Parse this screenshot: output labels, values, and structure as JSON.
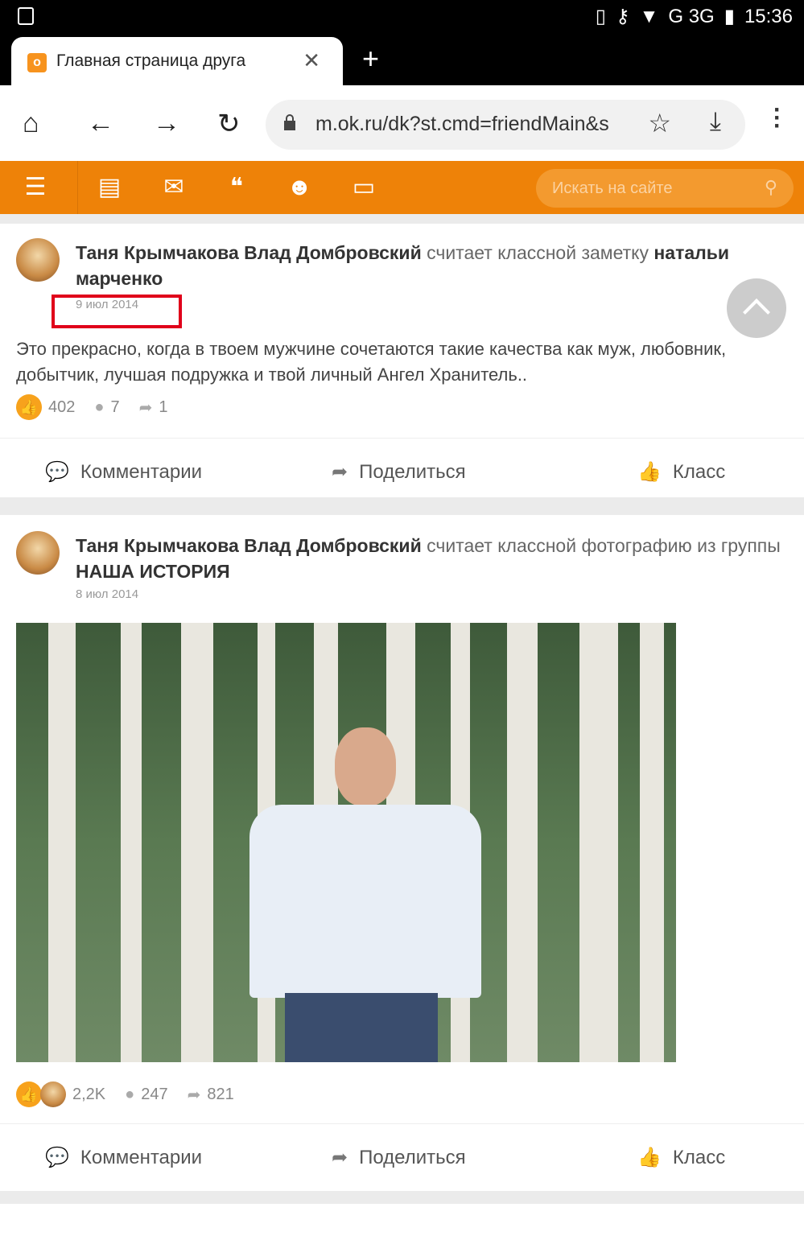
{
  "status_bar": {
    "time": "15:36",
    "network": "G 3G"
  },
  "browser": {
    "tab_title": "Главная страница друга",
    "url": "m.ok.ru/dk?st.cmd=friendMain&s"
  },
  "ok_header": {
    "search_placeholder": "Искать на сайте"
  },
  "posts": [
    {
      "authors": "Таня Крымчакова Влад Домбровский",
      "action": "считает классной заметку",
      "target": "натальи марченко",
      "date": "9 июл 2014",
      "text": "Это прекрасно, когда в твоем мужчине сочетаются такие качества как муж, любовник, добытчик, лучшая подружка и твой личный Ангел Хранитель..",
      "likes": "402",
      "comments": "7",
      "shares": "1"
    },
    {
      "authors": "Таня Крымчакова Влад Домбровский",
      "action": "считает классной фотографию из группы",
      "target": "НАША ИСТОРИЯ",
      "date": "8 июл 2014",
      "likes": "2,2K",
      "comments": "247",
      "shares": "821"
    }
  ],
  "actions": {
    "comments": "Комментарии",
    "share": "Поделиться",
    "like": "Класс"
  }
}
